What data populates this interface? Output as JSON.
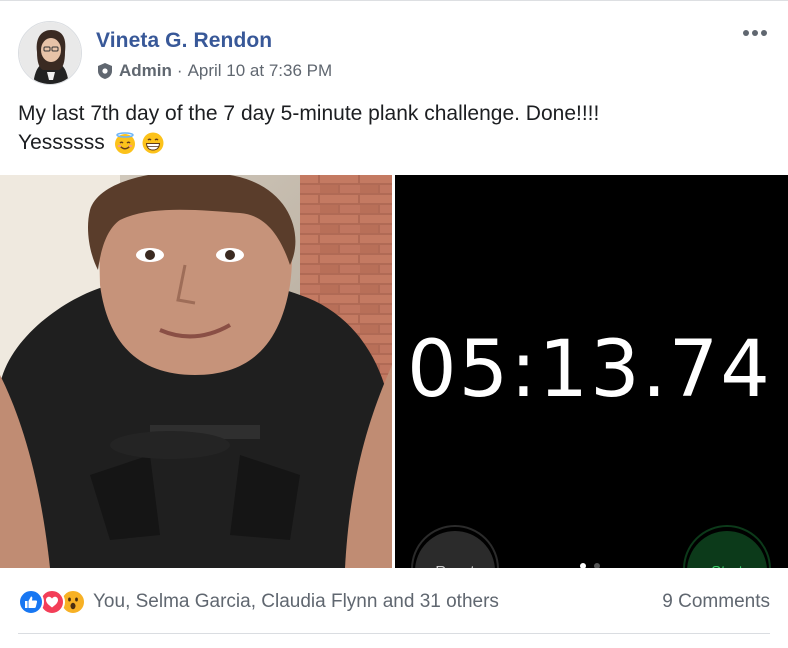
{
  "post": {
    "author": "Vineta G. Rendon",
    "role": "Admin",
    "separator": "·",
    "timestamp": "April 10 at 7:36 PM",
    "text_line1": "My last 7th day of the 7 day 5-minute plank challenge. Done!!!!",
    "text_line2": "Yessssss",
    "emojis": [
      "smiling-face-with-halo-icon",
      "grinning-face-icon"
    ]
  },
  "photo_right": {
    "timer": "05:13.74",
    "reset_label": "Reset",
    "start_label": "Start"
  },
  "footer": {
    "reaction_icons": [
      "like-icon",
      "love-icon",
      "wow-icon"
    ],
    "reaction_names": "You, Selma Garcia, Claudia Flynn and 31 others",
    "comments": "9 Comments"
  },
  "colors": {
    "author_blue": "#385898",
    "secondary_text": "#606770",
    "like_blue": "#1877f2",
    "love_red": "#f33e58",
    "wow_yellow": "#f7b125",
    "stopwatch_green": "#3cd06b"
  }
}
